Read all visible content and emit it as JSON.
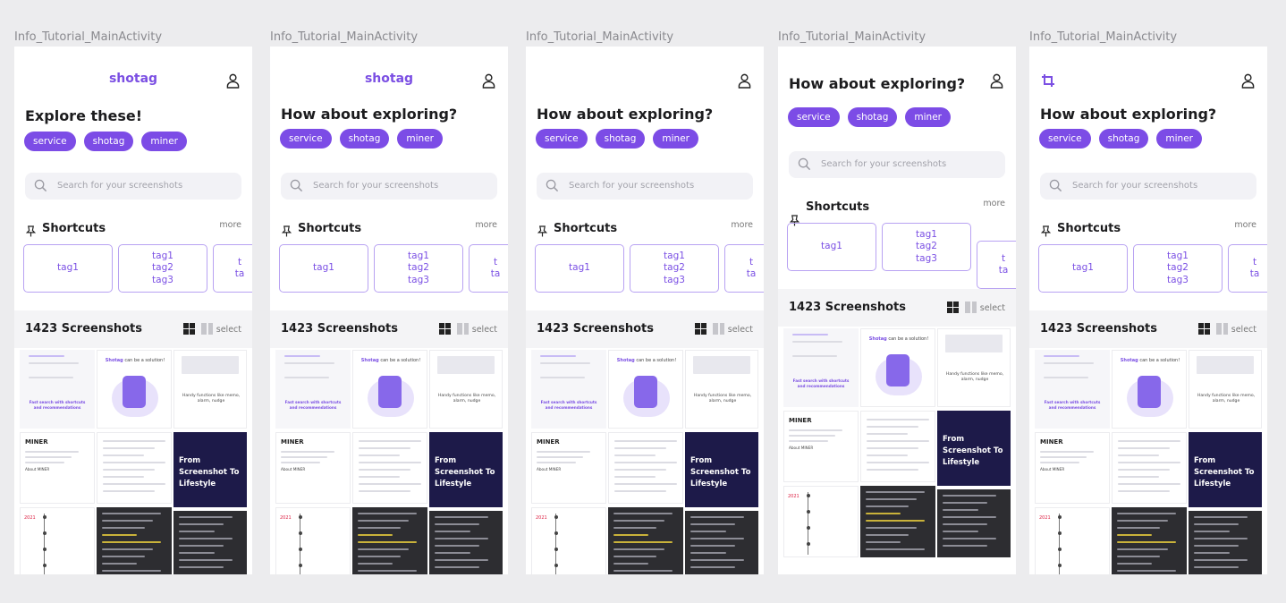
{
  "frames": [
    {
      "label": "Info_Tutorial_MainActivity",
      "variant": "logo-text",
      "heading": "Explore these!"
    },
    {
      "label": "Info_Tutorial_MainActivity",
      "variant": "logo-text",
      "heading": "How about exploring?"
    },
    {
      "label": "Info_Tutorial_MainActivity",
      "variant": "no-logo",
      "heading": "How about exploring?"
    },
    {
      "label": "Info_Tutorial_MainActivity",
      "variant": "scrolled",
      "heading": "How about exploring?"
    },
    {
      "label": "Info_Tutorial_MainActivity",
      "variant": "icon-logo",
      "heading": "How about exploring?"
    }
  ],
  "app": {
    "logo_text": "shotag",
    "logo_icon": "crop-tag-icon",
    "user_icon": "user-icon"
  },
  "chips": [
    "service",
    "shotag",
    "miner"
  ],
  "search": {
    "placeholder": "Search for your screenshots"
  },
  "shortcuts": {
    "title": "Shortcuts",
    "more": "more",
    "cards": [
      [
        "tag1"
      ],
      [
        "tag1",
        "tag2",
        "tag3"
      ],
      [
        "t",
        "ta"
      ]
    ]
  },
  "screenshots": {
    "count_label": "1423 Screenshots",
    "select": "select"
  },
  "thumbs": {
    "solution": "can be a solution!",
    "solution_brand": "Shotag",
    "fast_search": "Fast search with shortcuts and recommendations",
    "handy": "Handy functions like memo, alarm, nudge",
    "miner": "MINER",
    "about": "About MINER",
    "from": "From Screenshot To Lifestyle",
    "year": "2021"
  },
  "colors": {
    "accent": "#7c4ce6",
    "dark_card": "#1d1a49",
    "grey_card": "#2d2d31"
  }
}
